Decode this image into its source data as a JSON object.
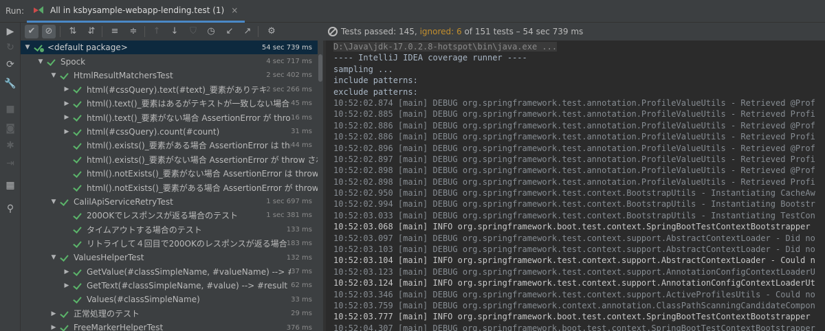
{
  "run": {
    "label": "Run:",
    "tab_title": "All in ksbysample-webapp-lending.test (1)",
    "close": "×"
  },
  "status": {
    "passed": "Tests passed: 145,",
    "ignored": "ignored: 6",
    "rest": "of 151 tests – 54 sec 739 ms"
  },
  "colors": {
    "passed": "#5bb46a",
    "ignored": "#c28e2d",
    "selected_row": "#0d293e",
    "tab_underline": "#4a88c7"
  },
  "toolbar": {
    "buttons": [
      {
        "name": "show-passed-icon",
        "glyph": "✔"
      },
      {
        "name": "show-ignored-icon",
        "glyph": "⊘"
      },
      {
        "name": "sort-alpha-icon",
        "glyph": "⇅"
      },
      {
        "name": "sort-duration-icon",
        "glyph": "⇵"
      },
      {
        "name": "expand-all-icon",
        "glyph": "≡"
      },
      {
        "name": "collapse-all-icon",
        "glyph": "≑"
      },
      {
        "name": "previous-failed-icon",
        "glyph": "↑"
      },
      {
        "name": "next-failed-icon",
        "glyph": "↓"
      },
      {
        "name": "shield-icon",
        "glyph": "⛉"
      },
      {
        "name": "history-icon",
        "glyph": "◷"
      },
      {
        "name": "import-tests-icon",
        "glyph": "↙"
      },
      {
        "name": "export-tests-icon",
        "glyph": "↗"
      },
      {
        "name": "settings-gear-icon",
        "glyph": "⚙"
      }
    ]
  },
  "leftbar": {
    "buttons": [
      {
        "name": "rerun-icon",
        "glyph": "▶"
      },
      {
        "name": "rerun-failed-icon",
        "glyph": "↻"
      },
      {
        "name": "toggle-auto-test-icon",
        "glyph": "⟳"
      },
      {
        "name": "wrench-icon",
        "glyph": "🔧"
      },
      {
        "name": "stop-icon",
        "glyph": "■"
      },
      {
        "name": "camera-icon",
        "glyph": "◙"
      },
      {
        "name": "debug-icon",
        "glyph": "✱"
      },
      {
        "name": "exit-icon",
        "glyph": "⇥"
      },
      {
        "name": "layout-icon",
        "glyph": "▦"
      },
      {
        "name": "pin-icon",
        "glyph": "⚲"
      }
    ]
  },
  "tree": {
    "rows": [
      {
        "label": "<default package>",
        "time": "54 sec 739 ms",
        "depth": 0,
        "arrow": "open",
        "pkg": true,
        "selected": true
      },
      {
        "label": "Spock",
        "time": "4 sec 717 ms",
        "depth": 1,
        "arrow": "open"
      },
      {
        "label": "HtmlResultMatchersTest",
        "time": "2 sec 402 ms",
        "depth": 2,
        "arrow": "open"
      },
      {
        "label": "html(#cssQuery).text(#text)_要素がありテキストが一",
        "time": "2 sec 266 ms",
        "depth": 3,
        "arrow": "closed"
      },
      {
        "label": "html().text()_要素はあるがテキストが一致しない場合 Assert",
        "time": "45 ms",
        "depth": 3,
        "arrow": "closed"
      },
      {
        "label": "html().text()_要素がない場合 AssertionError が throw され",
        "time": "16 ms",
        "depth": 3,
        "arrow": "closed"
      },
      {
        "label": "html(#cssQuery).count(#count)",
        "time": "31 ms",
        "depth": 3,
        "arrow": "closed"
      },
      {
        "label": "html().exists()_要素がある場合 AssertionError は throw さ",
        "time": "44 ms",
        "depth": 3,
        "arrow": "none"
      },
      {
        "label": "html().exists()_要素がない場合 AssertionError が throw される",
        "time": "",
        "depth": 3,
        "arrow": "none"
      },
      {
        "label": "html().notExists()_要素がない場合 AssertionError は throw されな",
        "time": "",
        "depth": 3,
        "arrow": "none"
      },
      {
        "label": "html().notExists()_要素がある場合 AssertionError が throw されな",
        "time": "",
        "depth": 3,
        "arrow": "none"
      },
      {
        "label": "CalilApiServiceRetryTest",
        "time": "1 sec 697 ms",
        "depth": 2,
        "arrow": "open"
      },
      {
        "label": "200OKでレスポンスが返る場合のテスト",
        "time": "1 sec 381 ms",
        "depth": 3,
        "arrow": "none"
      },
      {
        "label": "タイムアウトする場合のテスト",
        "time": "133 ms",
        "depth": 3,
        "arrow": "none"
      },
      {
        "label": "リトライして４回目で200OKのレスポンスが返る場合のテスト",
        "time": "183 ms",
        "depth": 3,
        "arrow": "none"
      },
      {
        "label": "ValuesHelperTest",
        "time": "132 ms",
        "depth": 2,
        "arrow": "open"
      },
      {
        "label": "GetValue(#classSimpleName, #valueName) --> #resul",
        "time": "37 ms",
        "depth": 3,
        "arrow": "closed"
      },
      {
        "label": "GetText(#classSimpleName, #value) --> #result",
        "time": "62 ms",
        "depth": 3,
        "arrow": "closed"
      },
      {
        "label": "Values(#classSimpleName)",
        "time": "33 ms",
        "depth": 3,
        "arrow": "none"
      },
      {
        "label": "正常処理のテスト",
        "time": "29 ms",
        "depth": 2,
        "arrow": "closed"
      },
      {
        "label": "FreeMarkerHelperTest",
        "time": "376 ms",
        "depth": 2,
        "arrow": "closed"
      }
    ]
  },
  "console": {
    "lines": [
      {
        "kind": "cmd",
        "text": "D:\\Java\\jdk-17.0.2.8-hotspot\\bin\\java.exe ..."
      },
      {
        "kind": "plain",
        "text": "---- IntelliJ IDEA coverage runner ----"
      },
      {
        "kind": "plain",
        "text": "sampling ..."
      },
      {
        "kind": "plain",
        "text": "include patterns:"
      },
      {
        "kind": "plain",
        "text": "exclude patterns:"
      },
      {
        "kind": "debug",
        "text": "10:52:02.874 [main] DEBUG org.springframework.test.annotation.ProfileValueUtils - Retrieved @Prof"
      },
      {
        "kind": "debug",
        "text": "10:52:02.885 [main] DEBUG org.springframework.test.annotation.ProfileValueUtils - Retrieved Profi"
      },
      {
        "kind": "debug",
        "text": "10:52:02.886 [main] DEBUG org.springframework.test.annotation.ProfileValueUtils - Retrieved @Prof"
      },
      {
        "kind": "debug",
        "text": "10:52:02.886 [main] DEBUG org.springframework.test.annotation.ProfileValueUtils - Retrieved Profi"
      },
      {
        "kind": "debug",
        "text": "10:52:02.896 [main] DEBUG org.springframework.test.annotation.ProfileValueUtils - Retrieved @Prof"
      },
      {
        "kind": "debug",
        "text": "10:52:02.897 [main] DEBUG org.springframework.test.annotation.ProfileValueUtils - Retrieved Profi"
      },
      {
        "kind": "debug",
        "text": "10:52:02.898 [main] DEBUG org.springframework.test.annotation.ProfileValueUtils - Retrieved @Prof"
      },
      {
        "kind": "debug",
        "text": "10:52:02.898 [main] DEBUG org.springframework.test.annotation.ProfileValueUtils - Retrieved Profi"
      },
      {
        "kind": "debug",
        "text": "10:52:02.950 [main] DEBUG org.springframework.test.context.BootstrapUtils - Instantiating CacheAw"
      },
      {
        "kind": "debug",
        "text": "10:52:02.994 [main] DEBUG org.springframework.test.context.BootstrapUtils - Instantiating Bootstr"
      },
      {
        "kind": "debug",
        "text": "10:52:03.033 [main] DEBUG org.springframework.test.context.BootstrapUtils - Instantiating TestCon"
      },
      {
        "kind": "info",
        "text": "10:52:03.068 [main] INFO org.springframework.boot.test.context.SpringBootTestContextBootstrapper"
      },
      {
        "kind": "debug",
        "text": "10:52:03.097 [main] DEBUG org.springframework.test.context.support.AbstractContextLoader - Did no"
      },
      {
        "kind": "debug",
        "text": "10:52:03.103 [main] DEBUG org.springframework.test.context.support.AbstractContextLoader - Did no"
      },
      {
        "kind": "info",
        "text": "10:52:03.104 [main] INFO org.springframework.test.context.support.AbstractContextLoader - Could n"
      },
      {
        "kind": "debug",
        "text": "10:52:03.123 [main] DEBUG org.springframework.test.context.support.AnnotationConfigContextLoaderU"
      },
      {
        "kind": "info",
        "text": "10:52:03.124 [main] INFO org.springframework.test.context.support.AnnotationConfigContextLoaderUt"
      },
      {
        "kind": "debug",
        "text": "10:52:03.346 [main] DEBUG org.springframework.test.context.support.ActiveProfilesUtils - Could no"
      },
      {
        "kind": "debug",
        "text": "10:52:03.759 [main] DEBUG org.springframework.context.annotation.ClassPathScanningCandidateCompon"
      },
      {
        "kind": "info",
        "text": "10:52:03.777 [main] INFO org.springframework.boot.test.context.SpringBootTestContextBootstrapper"
      },
      {
        "kind": "debug",
        "text": "10:52:04.307 [main] DEBUG org.springframework.boot.test.context.SpringBootTestContextBootstrapper"
      }
    ]
  }
}
